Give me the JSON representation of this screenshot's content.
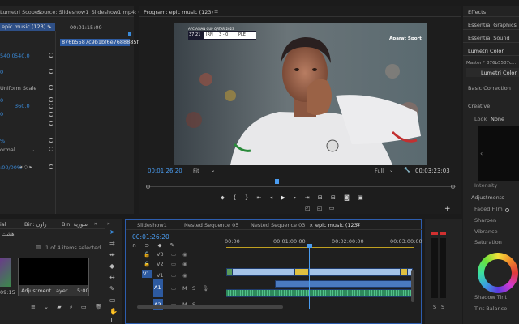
{
  "effect_controls": {
    "tab1": "Lumetri Scopes",
    "tab2": "Source: Slideshow1_Slideshow1.mp4: 0",
    "clip_label": "epic music (123) *...",
    "timecode": "00:01:15:00",
    "clip_name": "876b5587c9b1bf6e7688885f2",
    "values": {
      "position_x": "540.0",
      "position_y": "540.0",
      "scale": "0",
      "uniform_scale": "Uniform Scale",
      "rot_a": "0",
      "rot_b": "0",
      "anchor_y": "360.0",
      "anchor_x": "0",
      "opacity": "% ",
      "blend": "ormal",
      "ts": ":00/00%"
    }
  },
  "program": {
    "title": "Program: epic music (123)",
    "timecode_left": "00:01:26:20",
    "fit": "Fit",
    "quality": "Full",
    "timecode_right": "00:03:23:03",
    "overlay_top": "AFC ASIAN CUP QATAR 2023",
    "score_time": "37:21",
    "team_a": "IRN",
    "score": "3 - 0",
    "team_b": "PLE",
    "watermark": "Aparat Sport"
  },
  "right_panel": {
    "items": [
      "Effects",
      "Essential Graphics",
      "Essential Sound",
      "Lumetri Color"
    ],
    "master": "Master * 876b5587c...",
    "lumetri_color": "Lumetri Color",
    "basic_correction": "Basic Correction",
    "creative": "Creative",
    "look": "Look",
    "look_value": "None",
    "intensity": "Intensity",
    "adjustments": "Adjustments",
    "faded_film": "Faded Film",
    "sharpen": "Sharpen",
    "vibrance": "Vibrance",
    "saturation": "Saturation",
    "shadow_tint": "Shadow Tint",
    "tint_balance": "Tint Balance"
  },
  "project": {
    "tab_a": "Bin: سورية",
    "tab_b": "Bin: زاون",
    "tab_c": "ial",
    "search_hint": "هشت",
    "count": "1 of 4 items selected",
    "item_label": "Adjustment Layer",
    "item_duration": "5:00",
    "left_duration": "09:15"
  },
  "timeline": {
    "tabs": [
      "Slideshow1",
      "Nested Sequence 05",
      "Nested Sequence 03",
      "epic music (123)"
    ],
    "timecode": "00:01:26:20",
    "ruler": [
      "00:00",
      "00:01:00:00",
      "00:02:00:00",
      "00:03:00:00"
    ],
    "tracks": {
      "v3": "V3",
      "v2": "V2",
      "v1": "V1",
      "a1": "A1",
      "a2": "A2",
      "m": "M",
      "s": "S"
    }
  },
  "audio_meter": {
    "left": "S",
    "right": "S"
  }
}
